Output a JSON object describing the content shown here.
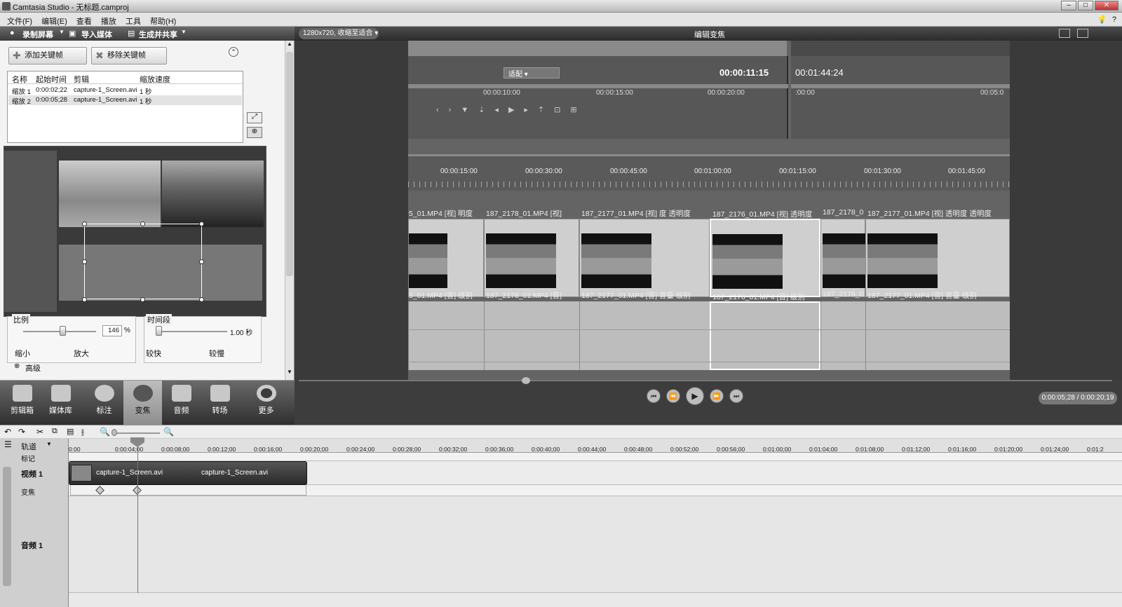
{
  "window": {
    "title": "Camtasia Studio - 无标题.camproj",
    "minimize": "–",
    "maximize": "□",
    "close": "✕"
  },
  "menu": [
    "文件(F)",
    "编辑(E)",
    "查看",
    "播放",
    "工具",
    "帮助(H)"
  ],
  "menu_right": [
    "💡",
    "?"
  ],
  "toolbar": {
    "record": "录制屏幕",
    "import": "导入媒体",
    "produce": "生成并共享"
  },
  "zoom_panel": {
    "add_keyframe": "添加关键帧",
    "remove_keyframe": "移除关键帧",
    "columns": [
      "名称",
      "起始时间",
      "剪辑",
      "缩放速度"
    ],
    "rows": [
      {
        "name": "缩放 1",
        "start": "0:00:02;22",
        "clip": "capture-1_Screen.avi",
        "speed": "1 秒"
      },
      {
        "name": "缩放 2",
        "start": "0:00:05;28",
        "clip": "capture-1_Screen.avi",
        "speed": "1 秒"
      }
    ],
    "scale": {
      "label": "比例",
      "value": "146",
      "unit": "%",
      "min_label": "缩小",
      "max_label": "放大"
    },
    "duration": {
      "label": "时间段",
      "value": "1.00 秒",
      "min_label": "较快",
      "max_label": "较慢"
    },
    "advanced": "高级"
  },
  "tools": [
    {
      "label": "剪辑箱",
      "icon": "clip-bin-icon",
      "active": false
    },
    {
      "label": "媒体库",
      "icon": "library-icon",
      "active": false
    },
    {
      "label": "标注",
      "icon": "callout-icon",
      "active": false
    },
    {
      "label": "变焦",
      "icon": "zoom-icon",
      "active": true
    },
    {
      "label": "音频",
      "icon": "audio-icon",
      "active": false
    },
    {
      "label": "转场",
      "icon": "transition-icon",
      "active": false
    },
    {
      "label": "更多",
      "icon": "more-icon",
      "active": false
    }
  ],
  "canvas_header": {
    "resolution": "1280x720, 收缩至适合",
    "title": "编辑变焦"
  },
  "inner_editor": {
    "fit": "适配",
    "timecode_left": "00:00:11:15",
    "timecode_right": "00:01:44:24",
    "top_ruler": [
      "00:00:10:00",
      "00:00:15:00",
      "00:00:20:00"
    ],
    "right_ruler": [
      ":00:00",
      "00:05:0"
    ],
    "main_ruler": [
      "00:00:15:00",
      "00:00:30:00",
      "00:00:45:00",
      "00:01:00:00",
      "00:01:15:00",
      "00:01:30:00",
      "00:01:45:00"
    ],
    "video_clips": [
      "5_01.MP4 [视] 明度",
      "187_2178_01.MP4 [视]",
      "187_2177_01.MP4 [视] 度 透明度",
      "187_2176_01.MP4 [视] 透明度",
      "187_2178_0",
      "187_2177_01.MP4 [视] 透明度 透明度"
    ],
    "audio_clips": [
      "5_01.MP4 [音] 级别",
      "187_2178_01.MP4 [音]",
      "187_2177_01.MP4 [音] 音量 级别",
      "187_2176_01.MP4 [音] 级别",
      "187_2178_0",
      "187_2177_01.MP4 [音] 音量 级别"
    ]
  },
  "playback": {
    "position": "0:00:05;28 / 0:00:20;19"
  },
  "timeline": {
    "tracks_label": "轨道",
    "markers_label": "标记",
    "video_track": "视频 1",
    "zoom_track": "变焦",
    "audio_track": "音频 1",
    "clip_labels": [
      "capture-1_Screen.avi",
      "capture-1_Screen.avi"
    ],
    "ruler": [
      "0:00",
      "0:00:04;00",
      "0:00:08;00",
      "0:00:12;00",
      "0:00:16;00",
      "0:00:20;00",
      "0:00:24;00",
      "0:00:28;00",
      "0:00:32;00",
      "0:00:36;00",
      "0:00:40;00",
      "0:00:44;00",
      "0:00:48;00",
      "0:00:52;00",
      "0:00:56;00",
      "0:01:00;00",
      "0:01:04;00",
      "0:01:08;00",
      "0:01:12;00",
      "0:01:16;00",
      "0:01:20;00",
      "0:01:24;00",
      "0:01:2"
    ]
  }
}
